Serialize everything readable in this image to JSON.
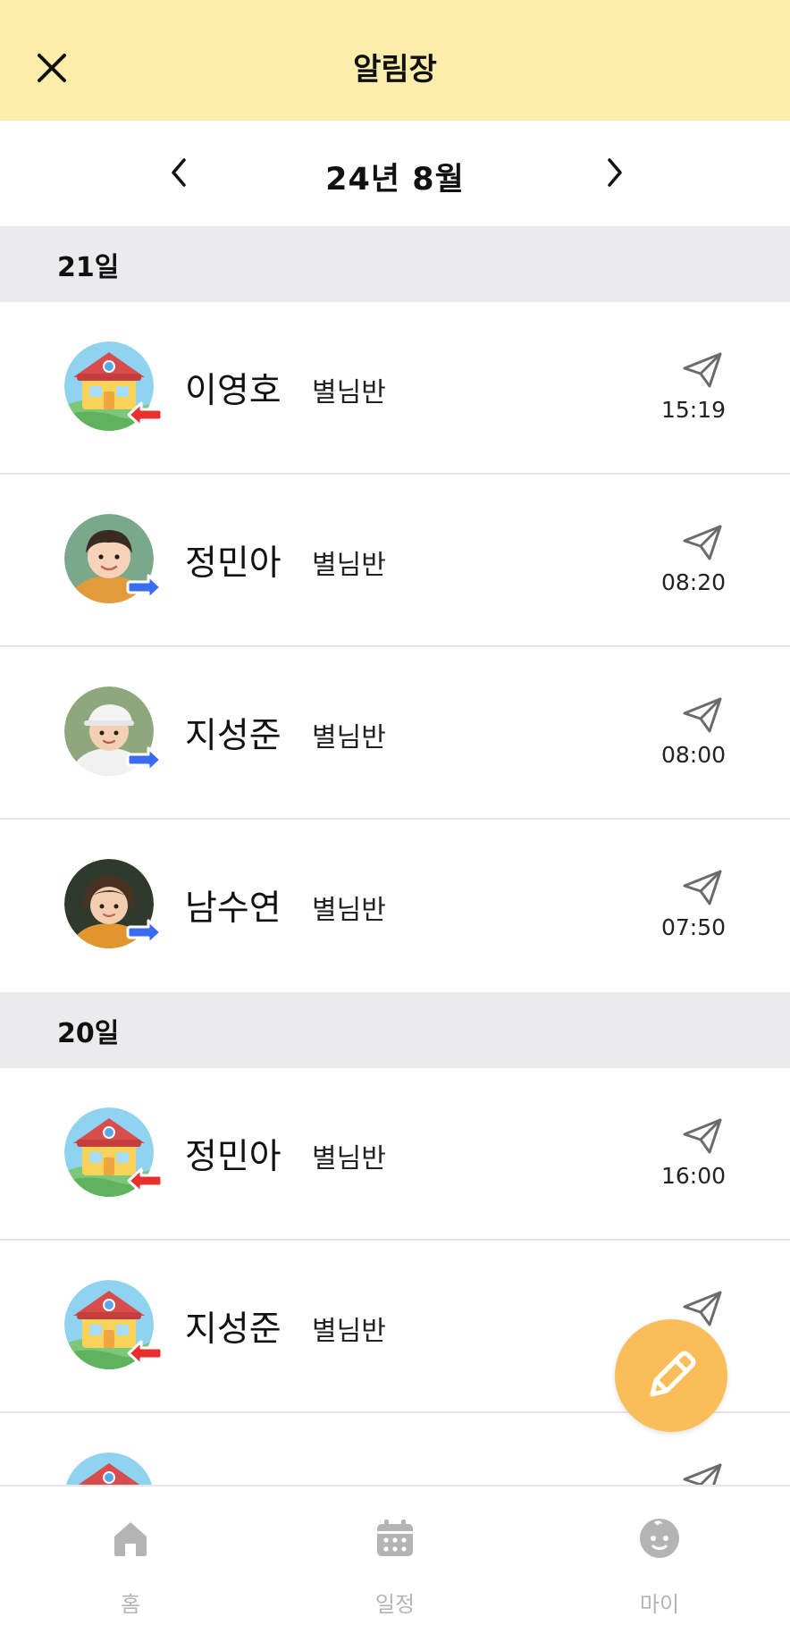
{
  "header": {
    "title": "알림장",
    "close_icon": "close-icon",
    "bg_color": "#fcedaa"
  },
  "month_nav": {
    "label": "24년 8월",
    "prev_icon": "chevron-left-icon",
    "next_icon": "chevron-right-icon"
  },
  "groups": [
    {
      "day": "21일",
      "entries": [
        {
          "name": "이영호",
          "class": "별님반",
          "time": "15:19",
          "avatar": "school-building",
          "direction": "in",
          "status_icon": "paper-plane-icon"
        },
        {
          "name": "정민아",
          "class": "별님반",
          "time": "08:20",
          "avatar": "child-photo",
          "direction": "out",
          "status_icon": "paper-plane-icon"
        },
        {
          "name": "지성준",
          "class": "별님반",
          "time": "08:00",
          "avatar": "child-photo",
          "direction": "out",
          "status_icon": "paper-plane-icon"
        },
        {
          "name": "남수연",
          "class": "별님반",
          "time": "07:50",
          "avatar": "child-photo",
          "direction": "out",
          "status_icon": "paper-plane-icon"
        }
      ]
    },
    {
      "day": "20일",
      "entries": [
        {
          "name": "정민아",
          "class": "별님반",
          "time": "16:00",
          "avatar": "school-building",
          "direction": "in",
          "status_icon": "paper-plane-icon"
        },
        {
          "name": "지성준",
          "class": "별님반",
          "time": "",
          "avatar": "school-building",
          "direction": "in",
          "status_icon": "paper-plane-icon"
        }
      ]
    }
  ],
  "fab": {
    "icon": "pencil-icon",
    "color": "#f9bd5a"
  },
  "tabbar": {
    "tabs": [
      {
        "label": "홈",
        "icon": "home-icon"
      },
      {
        "label": "일정",
        "icon": "calendar-icon"
      },
      {
        "label": "마이",
        "icon": "baby-face-icon"
      }
    ]
  },
  "colors": {
    "arrow_in": "#e8312e",
    "arrow_out": "#3a6cf0",
    "tab_inactive": "#b4b4b4"
  }
}
